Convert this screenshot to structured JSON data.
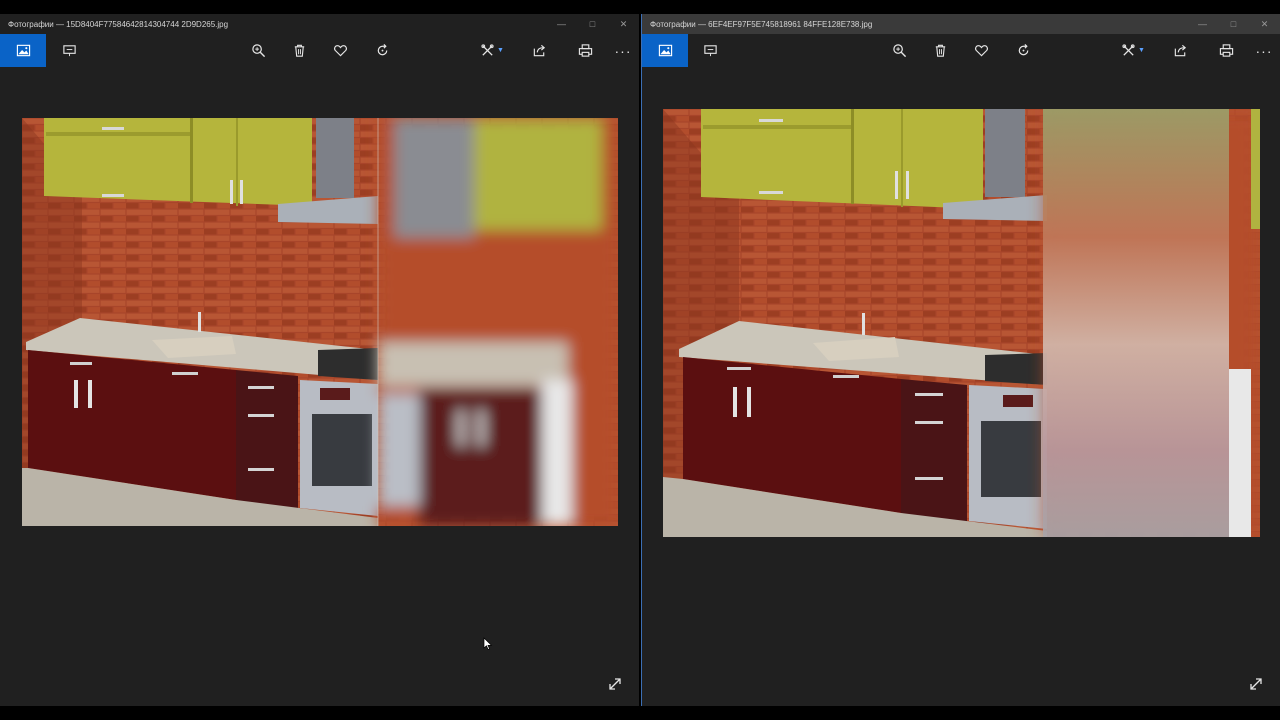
{
  "windows": [
    {
      "title": "Фотографии — 15D8404F77584642814304744 2D9D265.jpg",
      "toolbar": {
        "tools": [
          "view-icon",
          "slideshow-icon",
          "zoom-icon",
          "delete-icon",
          "favorite-icon",
          "rotate-icon",
          "edit-icon",
          "share-icon",
          "print-icon",
          "more-icon"
        ]
      }
    },
    {
      "title": "Фотографии — 6EF4EF97F5E745818961 84FFE128E738.jpg",
      "toolbar": {
        "tools": [
          "view-icon",
          "slideshow-icon",
          "zoom-icon",
          "delete-icon",
          "favorite-icon",
          "rotate-icon",
          "edit-icon",
          "share-icon",
          "print-icon",
          "more-icon"
        ]
      }
    }
  ],
  "colors": {
    "accent": "#0a63c7",
    "background": "#202020",
    "cabinet_upper": "#b7b63c",
    "cabinet_lower": "#5a1010",
    "brick": "#a24025",
    "countertop": "#c9c4b8",
    "floor": "#b8b2a6"
  }
}
